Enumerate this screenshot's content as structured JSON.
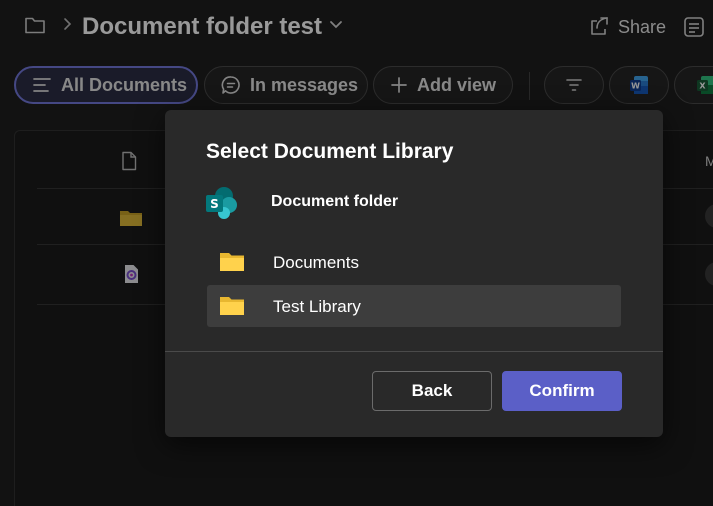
{
  "header": {
    "title": "Document folder test",
    "share_label": "Share",
    "icons": [
      "folder-icon",
      "chevron-right-icon",
      "chevron-down-icon",
      "share-icon",
      "details-panel-icon"
    ]
  },
  "viewbar": {
    "views": [
      {
        "label": "All Documents",
        "icon": "list-icon",
        "active": true
      },
      {
        "label": "In messages",
        "icon": "chat-icon",
        "active": false
      },
      {
        "label": "Add view",
        "icon": "plus-icon",
        "active": false
      }
    ],
    "tools": [
      "filter-icon",
      "word-icon",
      "excel-icon"
    ]
  },
  "list": {
    "column_partial_label": "M",
    "row_icons": [
      "folder-icon",
      "loop-file-icon"
    ]
  },
  "dialog": {
    "title": "Select Document Library",
    "site": {
      "name": "Document folder",
      "icon": "sharepoint-icon"
    },
    "libraries": [
      {
        "label": "Documents",
        "selected": false
      },
      {
        "label": "Test Library",
        "selected": true
      }
    ],
    "back_label": "Back",
    "confirm_label": "Confirm"
  },
  "colors": {
    "accent": "#5b5fc7",
    "active_pill_border": "#7479dc",
    "folder_yellow": "#ffd24c",
    "sharepoint_teal": "#038387",
    "dialog_bg": "#292929",
    "page_bg": "#1f1f1f"
  }
}
